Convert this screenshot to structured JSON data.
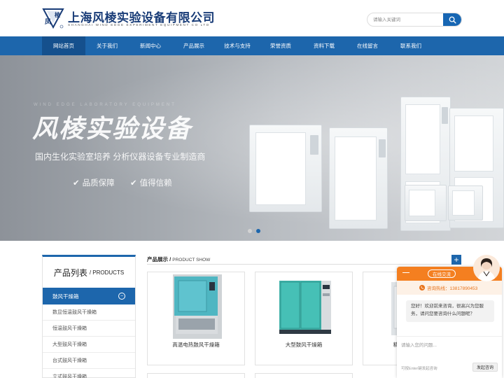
{
  "header": {
    "logo_text": "凤棱",
    "title": "上海风棱实验设备有限公司",
    "subtitle": "SHANGHAI WIND EDGE EXPERIMENT EQUIPMENT CO LTD",
    "search_placeholder": "请输入关键词"
  },
  "nav": {
    "items": [
      {
        "label": "网站首页"
      },
      {
        "label": "关于我们"
      },
      {
        "label": "新闻中心"
      },
      {
        "label": "产品展示"
      },
      {
        "label": "技术与支持"
      },
      {
        "label": "荣誉资质"
      },
      {
        "label": "资料下载"
      },
      {
        "label": "在线留言"
      },
      {
        "label": "联系我们"
      }
    ]
  },
  "banner": {
    "faint_text": "WIND EDGE LABORATORY EQUIPMENT",
    "title": "风棱实验设备",
    "subtitle": "国内生化实验室培养 分析仪器设备专业制造商",
    "features": [
      "品质保障",
      "值得信赖"
    ]
  },
  "sidebar": {
    "title_zh": "产品列表",
    "title_en": "/ PRODUCTS",
    "active_item": "鼓风干燥箱",
    "items": [
      "数显恒温鼓风干燥箱",
      "恒温鼓风干燥箱",
      "大型鼓风干燥箱",
      "台式鼓风干燥箱",
      "立式鼓风干燥箱"
    ]
  },
  "products": {
    "title_zh": "产品展示 /",
    "title_en": "PRODUCT SHOW",
    "cards": [
      {
        "label": "高温电热鼓风干燥箱"
      },
      {
        "label": "大型鼓风干燥箱"
      },
      {
        "label": "精密鼓风干燥箱"
      }
    ]
  },
  "chat": {
    "minimize": "—",
    "online_label": "在线交流",
    "hotline": "咨询热线：13817890453",
    "greeting": "您好！欢迎前来咨询，很高兴为您服务，请问您要咨询什么问题呢？",
    "input_placeholder": "请输入您的问题...",
    "hint": "可按Enter键发起咨询",
    "send_label": "发起咨询"
  },
  "colors": {
    "brand_blue": "#1d66ac",
    "chat_orange": "#f47f20"
  }
}
